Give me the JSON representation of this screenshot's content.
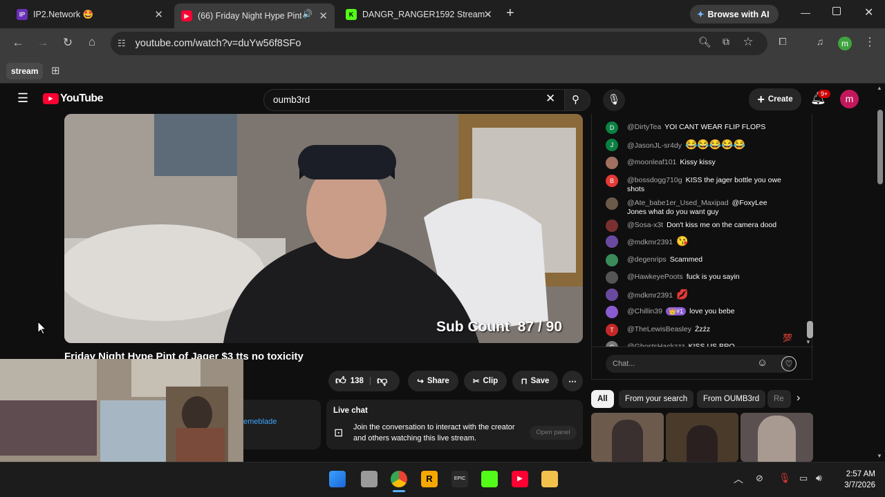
{
  "tabs": [
    {
      "title": "IP2.Network 🤩",
      "icon": "ip2-logo"
    },
    {
      "title": "(66) Friday Night Hype Pint",
      "icon": "youtube-logo"
    },
    {
      "title": "DANGR_RANGER1592 Stream -",
      "icon": "kick-logo"
    }
  ],
  "browse_ai": "Browse with AI",
  "url": "youtube.com/watch?v=duYw56f8SFo",
  "bookmark": "stream",
  "profile_letter": "m",
  "yt": {
    "logo": "YouTube",
    "search_value": "oumb3rd",
    "create": "Create",
    "notif_count": "9+",
    "video_overlay": "Sub Count  87 / 90",
    "title": "Friday Night Hype Pint of Jager $3 tts no toxicity",
    "like_count": "138",
    "share": "Share",
    "clip": "Clip",
    "save": "Save",
    "partial_channel": "emeblade",
    "live_chat_heading": "Live chat",
    "live_chat_desc": "Join the conversation to interact with the creator and others watching this live stream.",
    "open_panel": "Open panel",
    "chat_placeholder": "Chat...",
    "chips": [
      "All",
      "From your search",
      "From OUMB3rd",
      "Re"
    ]
  },
  "chat": [
    {
      "author": "@DirtyTea",
      "text": "YOI CANT WEAR FLIP FLOPS",
      "avatar": "D",
      "color": "#0b8043"
    },
    {
      "author": "@JasonJL-sr4dy",
      "text": "😂😂😂😂😂",
      "avatar": "J",
      "color": "#0b8043"
    },
    {
      "author": "@moonleaf101",
      "text": "Kissy kissy",
      "avatar": "",
      "color": "#a07060"
    },
    {
      "author": "@bossdogg710g",
      "text": "KISS the jager bottle you owe shots",
      "avatar": "B",
      "color": "#e53935"
    },
    {
      "author": "@Ate_babe1er_Used_Maxipad",
      "text": "@FoxyLee Jones what do you want guy",
      "avatar": "",
      "color": "#6b5a4a"
    },
    {
      "author": "@Sosa-x3t",
      "text": "Don't kiss me on the camera dood",
      "avatar": "",
      "color": "#7a3030"
    },
    {
      "author": "@mdkmr2391",
      "text": "😘",
      "avatar": "",
      "color": "#6a4aa0"
    },
    {
      "author": "@degenrips",
      "text": "Scammed",
      "avatar": "",
      "color": "#3a8a5a"
    },
    {
      "author": "@HawkeyePoots",
      "text": "fuck is you sayin",
      "avatar": "",
      "color": "#555555"
    },
    {
      "author": "@mdkmr2391",
      "text": "💋",
      "avatar": "",
      "color": "#6a4aa0"
    },
    {
      "author": "@Chillin39",
      "text": "love you bebe",
      "badge": "👑#1",
      "avatar": "",
      "color": "#8a5ad0"
    },
    {
      "author": "@TheLewisBeasley",
      "text": "Żzźz",
      "avatar": "T",
      "color": "#c62828"
    },
    {
      "author": "@GhostsHackzzz",
      "text": "KISS US BRO",
      "avatar": "G",
      "color": "#777777"
    }
  ],
  "clock": {
    "time": "2:57 AM",
    "date": "3/7/2026"
  }
}
